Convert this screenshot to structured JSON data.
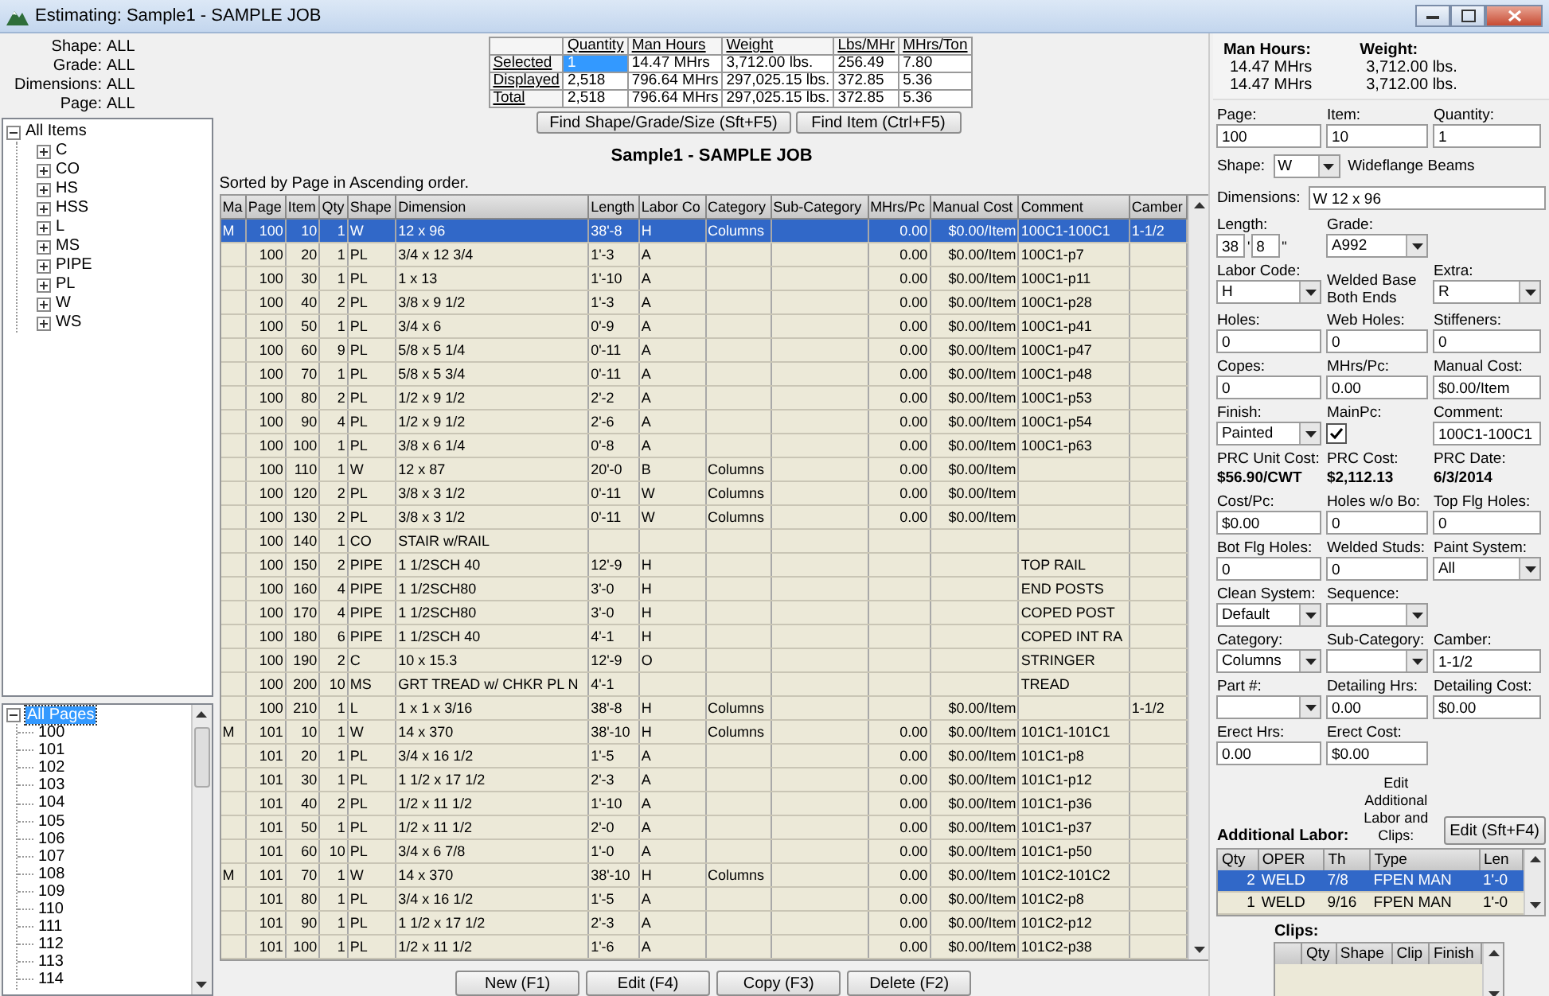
{
  "window": {
    "title": "Estimating: Sample1 - SAMPLE JOB"
  },
  "filters": [
    {
      "label": "Shape:",
      "value": "ALL"
    },
    {
      "label": "Grade:",
      "value": "ALL"
    },
    {
      "label": "Dimensions:",
      "value": "ALL"
    },
    {
      "label": "Page:",
      "value": "ALL"
    }
  ],
  "items_tree": {
    "label": "All Items",
    "expanded": true,
    "children": [
      {
        "label": "C",
        "expanded": false
      },
      {
        "label": "CO",
        "expanded": false
      },
      {
        "label": "HS",
        "expanded": false
      },
      {
        "label": "HSS",
        "expanded": false
      },
      {
        "label": "L",
        "expanded": false
      },
      {
        "label": "MS",
        "expanded": false
      },
      {
        "label": "PIPE",
        "expanded": false
      },
      {
        "label": "PL",
        "expanded": false
      },
      {
        "label": "W",
        "expanded": false
      },
      {
        "label": "WS",
        "expanded": false
      }
    ]
  },
  "pages_tree": {
    "label": "All Pages",
    "expanded": true,
    "selected": true,
    "children": [
      {
        "label": "100",
        "selected": false
      },
      {
        "label": "101",
        "selected": false
      },
      {
        "label": "102",
        "selected": false
      },
      {
        "label": "103",
        "selected": false
      },
      {
        "label": "104",
        "selected": false
      },
      {
        "label": "105",
        "selected": false
      },
      {
        "label": "106",
        "selected": false
      },
      {
        "label": "107",
        "selected": false
      },
      {
        "label": "108",
        "selected": false
      },
      {
        "label": "109",
        "selected": false
      },
      {
        "label": "110",
        "selected": false
      },
      {
        "label": "111",
        "selected": false
      },
      {
        "label": "112",
        "selected": false
      },
      {
        "label": "113",
        "selected": false
      },
      {
        "label": "114",
        "selected": false
      }
    ]
  },
  "summary": {
    "columns": [
      "Quantity",
      "Man Hours",
      "Weight",
      "Lbs/MHr",
      "MHrs/Ton"
    ],
    "rows": [
      {
        "label": "Selected",
        "selected": true,
        "cells": [
          "1",
          "14.47 MHrs",
          "3,712.00 lbs.",
          "256.49",
          "7.80"
        ]
      },
      {
        "label": "Displayed",
        "selected": false,
        "cells": [
          "2,518",
          "796.64 MHrs",
          "297,025.15 lbs.",
          "372.85",
          "5.36"
        ]
      },
      {
        "label": "Total",
        "selected": false,
        "cells": [
          "2,518",
          "796.64 MHrs",
          "297,025.15 lbs.",
          "372.85",
          "5.36"
        ]
      }
    ]
  },
  "find_buttons": [
    "Find Shape/Grade/Size (Sft+F5)",
    "Find Item (Ctrl+F5)"
  ],
  "job_title": "Sample1 - SAMPLE JOB",
  "sort_note": "Sorted by Page in Ascending order.",
  "table": {
    "columns": [
      "Ma",
      "Page",
      "Item",
      "Qty",
      "Shape",
      "Dimension",
      "Length",
      "Labor Co",
      "Category",
      "Sub-Category",
      "MHrs/Pc",
      "Manual Cost",
      "Comment",
      "Camber"
    ],
    "rows": [
      {
        "selected": true,
        "cells": [
          "M",
          "100",
          "10",
          "1",
          "W",
          "12 x 96",
          "38'-8",
          "H",
          "Columns",
          "",
          "0.00",
          "$0.00/Item",
          "100C1-100C1",
          "1-1/2"
        ]
      },
      {
        "selected": false,
        "cells": [
          "",
          "100",
          "20",
          "1",
          "PL",
          "3/4 x 12 3/4",
          "1'-3",
          "A",
          "",
          "",
          "0.00",
          "$0.00/Item",
          "100C1-p7",
          ""
        ]
      },
      {
        "selected": false,
        "cells": [
          "",
          "100",
          "30",
          "1",
          "PL",
          "1 x 13",
          "1'-10",
          "A",
          "",
          "",
          "0.00",
          "$0.00/Item",
          "100C1-p11",
          ""
        ]
      },
      {
        "selected": false,
        "cells": [
          "",
          "100",
          "40",
          "2",
          "PL",
          "3/8 x 9 1/2",
          "1'-3",
          "A",
          "",
          "",
          "0.00",
          "$0.00/Item",
          "100C1-p28",
          ""
        ]
      },
      {
        "selected": false,
        "cells": [
          "",
          "100",
          "50",
          "1",
          "PL",
          "3/4 x 6",
          "0'-9",
          "A",
          "",
          "",
          "0.00",
          "$0.00/Item",
          "100C1-p41",
          ""
        ]
      },
      {
        "selected": false,
        "cells": [
          "",
          "100",
          "60",
          "9",
          "PL",
          "5/8 x 5 1/4",
          "0'-11",
          "A",
          "",
          "",
          "0.00",
          "$0.00/Item",
          "100C1-p47",
          ""
        ]
      },
      {
        "selected": false,
        "cells": [
          "",
          "100",
          "70",
          "1",
          "PL",
          "5/8 x 5 3/4",
          "0'-11",
          "A",
          "",
          "",
          "0.00",
          "$0.00/Item",
          "100C1-p48",
          ""
        ]
      },
      {
        "selected": false,
        "cells": [
          "",
          "100",
          "80",
          "2",
          "PL",
          "1/2 x 9 1/2",
          "2'-2",
          "A",
          "",
          "",
          "0.00",
          "$0.00/Item",
          "100C1-p53",
          ""
        ]
      },
      {
        "selected": false,
        "cells": [
          "",
          "100",
          "90",
          "4",
          "PL",
          "1/2 x 9 1/2",
          "2'-6",
          "A",
          "",
          "",
          "0.00",
          "$0.00/Item",
          "100C1-p54",
          ""
        ]
      },
      {
        "selected": false,
        "cells": [
          "",
          "100",
          "100",
          "1",
          "PL",
          "3/8 x 6 1/4",
          "0'-8",
          "A",
          "",
          "",
          "0.00",
          "$0.00/Item",
          "100C1-p63",
          ""
        ]
      },
      {
        "selected": false,
        "cells": [
          "",
          "100",
          "110",
          "1",
          "W",
          "12 x 87",
          "20'-0",
          "B",
          "Columns",
          "",
          "0.00",
          "$0.00/Item",
          "",
          ""
        ]
      },
      {
        "selected": false,
        "cells": [
          "",
          "100",
          "120",
          "2",
          "PL",
          "3/8 x 3 1/2",
          "0'-11",
          "W",
          "Columns",
          "",
          "0.00",
          "$0.00/Item",
          "",
          ""
        ]
      },
      {
        "selected": false,
        "cells": [
          "",
          "100",
          "130",
          "2",
          "PL",
          "3/8 x 3 1/2",
          "0'-11",
          "W",
          "Columns",
          "",
          "0.00",
          "$0.00/Item",
          "",
          ""
        ]
      },
      {
        "selected": false,
        "cells": [
          "",
          "100",
          "140",
          "1",
          "CO",
          "STAIR w/RAIL",
          "",
          "",
          "",
          "",
          "",
          "",
          "",
          ""
        ]
      },
      {
        "selected": false,
        "cells": [
          "",
          "100",
          "150",
          "2",
          "PIPE",
          "1 1/2SCH 40",
          "12'-9",
          "H",
          "",
          "",
          "",
          "",
          "TOP RAIL",
          ""
        ]
      },
      {
        "selected": false,
        "cells": [
          "",
          "100",
          "160",
          "4",
          "PIPE",
          "1 1/2SCH80",
          "3'-0",
          "H",
          "",
          "",
          "",
          "",
          "END POSTS",
          ""
        ]
      },
      {
        "selected": false,
        "cells": [
          "",
          "100",
          "170",
          "4",
          "PIPE",
          "1 1/2SCH80",
          "3'-0",
          "H",
          "",
          "",
          "",
          "",
          "COPED POST",
          ""
        ]
      },
      {
        "selected": false,
        "cells": [
          "",
          "100",
          "180",
          "6",
          "PIPE",
          "1 1/2SCH 40",
          "4'-1",
          "H",
          "",
          "",
          "",
          "",
          "COPED INT RA",
          ""
        ]
      },
      {
        "selected": false,
        "cells": [
          "",
          "100",
          "190",
          "2",
          "C",
          "10 x 15.3",
          "12'-9",
          "O",
          "",
          "",
          "",
          "",
          "STRINGER",
          ""
        ]
      },
      {
        "selected": false,
        "cells": [
          "",
          "100",
          "200",
          "10",
          "MS",
          "GRT TREAD w/ CHKR PL N",
          "4'-1",
          "",
          "",
          "",
          "",
          "",
          "TREAD",
          ""
        ]
      },
      {
        "selected": false,
        "cells": [
          "",
          "100",
          "210",
          "1",
          "L",
          "1 x 1 x 3/16",
          "38'-8",
          "H",
          "Columns",
          "",
          "",
          "$0.00/Item",
          "",
          "1-1/2"
        ]
      },
      {
        "selected": false,
        "cells": [
          "M",
          "101",
          "10",
          "1",
          "W",
          "14 x 370",
          "38'-10",
          "H",
          "Columns",
          "",
          "0.00",
          "$0.00/Item",
          "101C1-101C1",
          ""
        ]
      },
      {
        "selected": false,
        "cells": [
          "",
          "101",
          "20",
          "1",
          "PL",
          "3/4 x 16 1/2",
          "1'-5",
          "A",
          "",
          "",
          "0.00",
          "$0.00/Item",
          "101C1-p8",
          ""
        ]
      },
      {
        "selected": false,
        "cells": [
          "",
          "101",
          "30",
          "1",
          "PL",
          "1 1/2 x 17 1/2",
          "2'-3",
          "A",
          "",
          "",
          "0.00",
          "$0.00/Item",
          "101C1-p12",
          ""
        ]
      },
      {
        "selected": false,
        "cells": [
          "",
          "101",
          "40",
          "2",
          "PL",
          "1/2 x 11 1/2",
          "1'-10",
          "A",
          "",
          "",
          "0.00",
          "$0.00/Item",
          "101C1-p36",
          ""
        ]
      },
      {
        "selected": false,
        "cells": [
          "",
          "101",
          "50",
          "1",
          "PL",
          "1/2 x 11 1/2",
          "2'-0",
          "A",
          "",
          "",
          "0.00",
          "$0.00/Item",
          "101C1-p37",
          ""
        ]
      },
      {
        "selected": false,
        "cells": [
          "",
          "101",
          "60",
          "10",
          "PL",
          "3/4 x 6 7/8",
          "1'-0",
          "A",
          "",
          "",
          "0.00",
          "$0.00/Item",
          "101C1-p50",
          ""
        ]
      },
      {
        "selected": false,
        "cells": [
          "M",
          "101",
          "70",
          "1",
          "W",
          "14 x 370",
          "38'-10",
          "H",
          "Columns",
          "",
          "0.00",
          "$0.00/Item",
          "101C2-101C2",
          ""
        ]
      },
      {
        "selected": false,
        "cells": [
          "",
          "101",
          "80",
          "1",
          "PL",
          "3/4 x 16 1/2",
          "1'-5",
          "A",
          "",
          "",
          "0.00",
          "$0.00/Item",
          "101C2-p8",
          ""
        ]
      },
      {
        "selected": false,
        "cells": [
          "",
          "101",
          "90",
          "1",
          "PL",
          "1 1/2 x 17 1/2",
          "2'-3",
          "A",
          "",
          "",
          "0.00",
          "$0.00/Item",
          "101C2-p12",
          ""
        ]
      },
      {
        "selected": false,
        "cells": [
          "",
          "101",
          "100",
          "1",
          "PL",
          "1/2 x 11 1/2",
          "1'-6",
          "A",
          "",
          "",
          "0.00",
          "$0.00/Item",
          "101C2-p38",
          ""
        ]
      }
    ]
  },
  "actions": [
    "New (F1)",
    "Edit (F4)",
    "Copy (F3)",
    "Delete (F2)"
  ],
  "totals": [
    {
      "label": "Man Hours:",
      "values": [
        "14.47 MHrs",
        "14.47 MHrs"
      ]
    },
    {
      "label": "Weight:",
      "values": [
        "3,712.00 lbs.",
        "3,712.00 lbs."
      ]
    }
  ],
  "form": [
    {
      "fields": [
        {
          "kind": "input",
          "label": "Page:",
          "value": "100"
        },
        {
          "kind": "input",
          "label": "Item:",
          "value": "10"
        },
        {
          "kind": "input",
          "label": "Quantity:",
          "value": "1"
        }
      ]
    },
    {
      "fields": [
        {
          "kind": "select_inline",
          "label": "Shape:",
          "value": "W"
        },
        {
          "kind": "note",
          "value": "Wideflange Beams"
        }
      ]
    },
    {
      "fields": [
        {
          "kind": "input_inline",
          "label": "Dimensions:",
          "value": "W 12 x 96"
        }
      ]
    },
    {
      "fields": [
        {
          "kind": "length",
          "label": "Length:",
          "values": [
            "38",
            "8"
          ],
          "marks": [
            "'",
            "\""
          ]
        },
        {
          "kind": "select",
          "label": "Grade:",
          "value": "A992"
        }
      ]
    },
    {
      "fields": [
        {
          "kind": "select",
          "label": "Labor Code:",
          "value": "H"
        },
        {
          "kind": "note",
          "value": "Welded Base Both Ends"
        },
        {
          "kind": "select",
          "label": "Extra:",
          "value": "R"
        }
      ]
    },
    {
      "fields": [
        {
          "kind": "input",
          "label": "Holes:",
          "value": "0"
        },
        {
          "kind": "input",
          "label": "Web Holes:",
          "value": "0"
        },
        {
          "kind": "input",
          "label": "Stiffeners:",
          "value": "0"
        }
      ]
    },
    {
      "fields": [
        {
          "kind": "input",
          "label": "Copes:",
          "value": "0"
        },
        {
          "kind": "input",
          "label": "MHrs/Pc:",
          "value": "0.00"
        },
        {
          "kind": "input",
          "label": "Manual Cost:",
          "value": "$0.00/Item"
        }
      ]
    },
    {
      "fields": [
        {
          "kind": "select",
          "label": "Finish:",
          "value": "Painted"
        },
        {
          "kind": "check",
          "label": "MainPc:",
          "checked": true
        },
        {
          "kind": "input",
          "label": "Comment:",
          "value": "100C1-100C1"
        }
      ]
    },
    {
      "fields": [
        {
          "kind": "info",
          "label": "PRC Unit Cost:",
          "value": "$56.90/CWT"
        },
        {
          "kind": "info",
          "label": "PRC Cost:",
          "value": "$2,112.13"
        },
        {
          "kind": "info",
          "label": "PRC Date:",
          "value": "6/3/2014"
        }
      ]
    },
    {
      "fields": [
        {
          "kind": "input",
          "label": "Cost/Pc:",
          "value": "$0.00"
        },
        {
          "kind": "input",
          "label": "Holes w/o Bo:",
          "value": "0"
        },
        {
          "kind": "input",
          "label": "Top Flg Holes:",
          "value": "0"
        }
      ]
    },
    {
      "fields": [
        {
          "kind": "input",
          "label": "Bot Flg Holes:",
          "value": "0"
        },
        {
          "kind": "input",
          "label": "Welded Studs:",
          "value": "0"
        },
        {
          "kind": "select",
          "label": "Paint System:",
          "value": "All"
        }
      ]
    },
    {
      "fields": [
        {
          "kind": "select",
          "label": "Clean System:",
          "value": "Default"
        },
        {
          "kind": "select",
          "label": "Sequence:"
        }
      ]
    },
    {
      "fields": [
        {
          "kind": "select",
          "label": "Category:",
          "value": "Columns"
        },
        {
          "kind": "select",
          "label": "Sub-Category:"
        },
        {
          "kind": "input",
          "label": "Camber:",
          "value": "1-1/2"
        }
      ]
    },
    {
      "fields": [
        {
          "kind": "select",
          "label": "Part #:"
        },
        {
          "kind": "input",
          "label": "Detailing Hrs:",
          "value": "0.00"
        },
        {
          "kind": "input",
          "label": "Detailing Cost:",
          "value": "$0.00"
        }
      ]
    },
    {
      "fields": [
        {
          "kind": "input",
          "label": "Erect Hrs:",
          "value": "0.00"
        },
        {
          "kind": "input",
          "label": "Erect Cost:",
          "value": "$0.00"
        }
      ]
    }
  ],
  "additional_labor": {
    "title": "Additional Labor:",
    "edit_note": "Edit Additional Labor and Clips:",
    "edit_button": "Edit (Sft+F4)",
    "columns": [
      "Qty",
      "OPER",
      "Th",
      "Type",
      "Len"
    ],
    "rows": [
      {
        "selected": true,
        "cells": [
          "2",
          "WELD",
          "7/8",
          "FPEN MAN",
          "1'-0"
        ]
      },
      {
        "selected": false,
        "cells": [
          "1",
          "WELD",
          "9/16",
          "FPEN MAN",
          "1'-0"
        ]
      }
    ]
  },
  "clips": {
    "title": "Clips:",
    "columns": [
      "Qty",
      "Shape",
      "Clip",
      "Finish"
    ]
  }
}
